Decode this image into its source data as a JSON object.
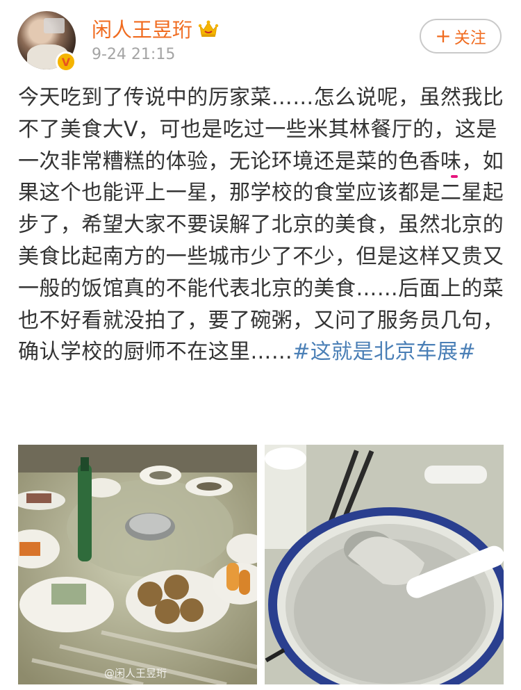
{
  "header": {
    "username": "闲人王昱珩",
    "time": "9-24 21:15",
    "follow_label": "关注",
    "follow_plus": "+",
    "badge_letter": "V"
  },
  "post": {
    "text_before": "今天吃到了传说中的厉家菜……怎么说呢，虽然我比不了美食大V，可也是吃过一些米其林餐厅的，",
    "highlight": "这是一次非常糟糕的体验",
    "text_after": "，无论环境还是菜的色香味，如果这个也能评上一星，那学校的食堂应该都是二星起步了，希望大家不要误解了北京的美食，虽然北京的美食比起南方的一些城市少了不少，但是这样又贵又一般的饭馆真的不能代表北京的美食……后面上的菜也不好看就没拍了，要了碗粥，又问了服务员几句，确认学校的厨师不在这里……",
    "hashtag": "#这就是北京车展#"
  },
  "photos": {
    "watermark": "@闲人王昱珩"
  },
  "colors": {
    "username": "#f06b1f",
    "hashtag": "#4a7fb6",
    "highlight_underline": "#e6157d",
    "body_text": "#333333"
  },
  "icons": [
    "avatar",
    "verified-v-badge-icon",
    "crown-icon",
    "plus-icon"
  ]
}
